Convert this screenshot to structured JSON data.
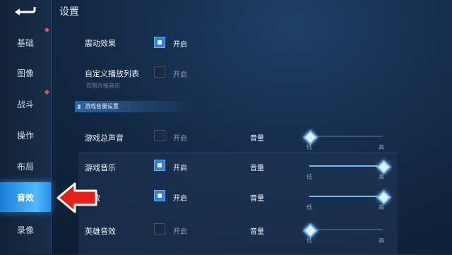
{
  "header": {
    "title": "设置"
  },
  "sidebar": {
    "items": [
      {
        "label": "基础",
        "active": false
      },
      {
        "label": "图像",
        "active": false
      },
      {
        "label": "战斗",
        "active": false
      },
      {
        "label": "操作",
        "active": false
      },
      {
        "label": "布局",
        "active": false
      },
      {
        "label": "音效",
        "active": true
      },
      {
        "label": "录像",
        "active": false
      }
    ]
  },
  "settings": {
    "vibration": {
      "label": "震动效果",
      "state_text": "开启",
      "checked": true
    },
    "custom_playlist": {
      "label": "自定义播放列表",
      "state_text": "开启",
      "checked": false,
      "hint": "仅限外接音乐"
    }
  },
  "section_title": "游戏音量设置",
  "audio_rows": [
    {
      "label": "游戏总声音",
      "state_text": "开启",
      "checked": false,
      "volume_label": "音量",
      "low": "低",
      "high": "高",
      "level": 0.0
    },
    {
      "label": "游戏音乐",
      "state_text": "开启",
      "checked": true,
      "volume_label": "音量",
      "low": "低",
      "high": "高",
      "level": 1.0
    },
    {
      "label": "音效",
      "state_text": "开启",
      "checked": true,
      "volume_label": "音量",
      "low": "低",
      "high": "高",
      "level": 1.0
    },
    {
      "label": "英雄音效",
      "state_text": "开启",
      "checked": false,
      "volume_label": "音量",
      "low": "低",
      "high": "高",
      "level": 0.0
    }
  ],
  "colors": {
    "accent": "#2f7fd6",
    "active_tab": "#3aa6f5",
    "arrow": "#e3201b"
  }
}
